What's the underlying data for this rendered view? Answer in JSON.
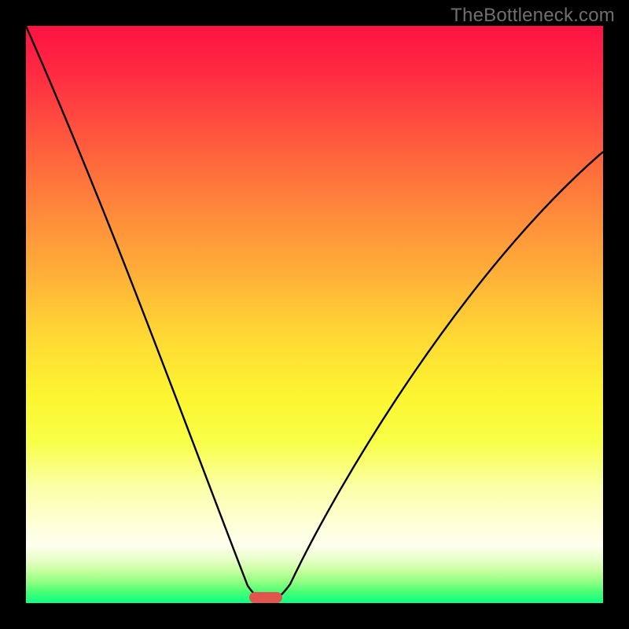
{
  "watermark": "TheBottleneck.com",
  "chart_data": {
    "type": "line",
    "title": "",
    "xlabel": "",
    "ylabel": "",
    "xlim": [
      0,
      1
    ],
    "ylim": [
      0,
      1
    ],
    "grid": false,
    "marker": {
      "x": 0.415,
      "y": 0.99
    },
    "series": [
      {
        "name": "left-curve",
        "x": [
          0.0,
          0.05,
          0.1,
          0.15,
          0.2,
          0.25,
          0.3,
          0.35,
          0.385,
          0.42
        ],
        "y": [
          0.0,
          0.19,
          0.35,
          0.49,
          0.62,
          0.73,
          0.83,
          0.91,
          0.97,
          1.0
        ]
      },
      {
        "name": "right-curve",
        "x": [
          0.42,
          0.46,
          0.52,
          0.6,
          0.7,
          0.8,
          0.9,
          1.0
        ],
        "y": [
          1.0,
          0.93,
          0.81,
          0.66,
          0.52,
          0.4,
          0.3,
          0.22
        ]
      }
    ]
  }
}
